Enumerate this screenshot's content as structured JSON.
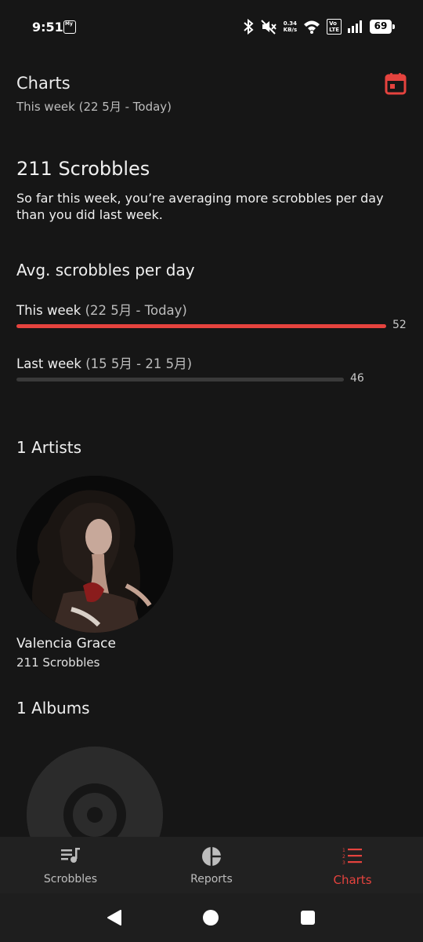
{
  "status_bar": {
    "time": "9:51",
    "app_badge": "My",
    "net_speed_value": "0.34",
    "net_speed_unit": "KB/s",
    "volte_top": "Vo",
    "volte_bottom": "LTE",
    "battery": "69"
  },
  "header": {
    "title": "Charts",
    "subtitle": "This week (22 5月 - Today)"
  },
  "summary": {
    "count": "211 Scrobbles",
    "text": "So far this week, you’re averaging more scrobbles per day than you did last week."
  },
  "avg": {
    "heading": "Avg. scrobbles per day",
    "this_week": {
      "label": "This week",
      "range": "(22 5月 - Today)",
      "value": "52",
      "fill": 1.0,
      "color": "#E5433E"
    },
    "last_week": {
      "label": "Last week",
      "range": "(15 5月 - 21 5月)",
      "value": "46",
      "fill": 0.885,
      "color": "#3A3A3A"
    }
  },
  "artists": {
    "title": "1 Artists",
    "items": [
      {
        "name": "Valencia Grace",
        "scrobbles": "211 Scrobbles"
      }
    ]
  },
  "albums": {
    "title": "1 Albums"
  },
  "bottom_nav": {
    "items": [
      {
        "label": "Scrobbles",
        "icon": "queue-music-icon"
      },
      {
        "label": "Reports",
        "icon": "pie-chart-icon"
      },
      {
        "label": "Charts",
        "icon": "numbered-list-icon",
        "active": true
      }
    ]
  },
  "colors": {
    "accent": "#E5433E",
    "background": "#161616",
    "nav_background": "#212121"
  }
}
